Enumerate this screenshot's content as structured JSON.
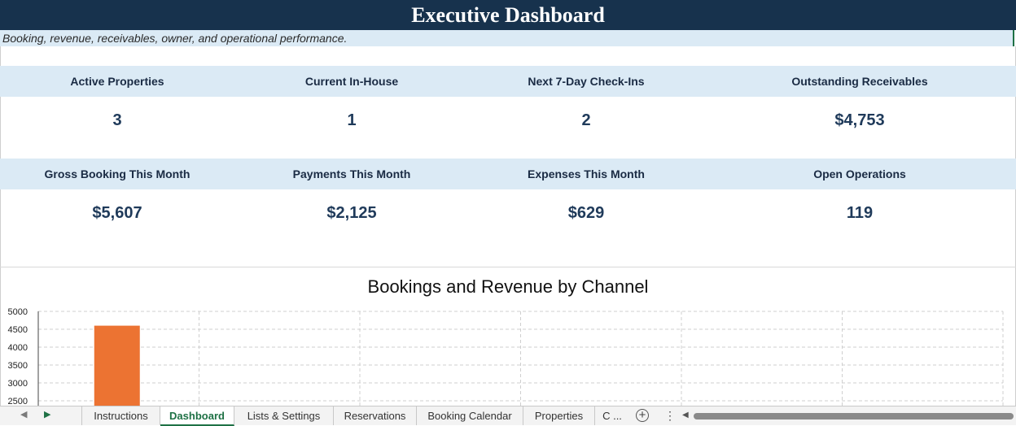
{
  "header": {
    "title": "Executive Dashboard",
    "subtitle": "Booking, revenue, receivables, owner, and operational performance."
  },
  "kpis_row1": [
    {
      "label": "Active Properties",
      "value": "3"
    },
    {
      "label": "Current In-House",
      "value": "1"
    },
    {
      "label": "Next 7-Day Check-Ins",
      "value": "2"
    },
    {
      "label": "Outstanding Receivables",
      "value": "$4,753"
    }
  ],
  "kpis_row2": [
    {
      "label": "Gross Booking This Month",
      "value": "$5,607"
    },
    {
      "label": "Payments This Month",
      "value": "$2,125"
    },
    {
      "label": "Expenses This Month",
      "value": "$629"
    },
    {
      "label": "Open Operations",
      "value": "119"
    }
  ],
  "chart_data": {
    "type": "bar",
    "title": "Bookings and Revenue by Channel",
    "y_ticks": [
      "5000",
      "4500",
      "4000",
      "3500",
      "3000",
      "2500"
    ],
    "ylim_visible": [
      2500,
      5000
    ],
    "grid": true,
    "categories_visible": 6,
    "series": [
      {
        "color": "#ec7332",
        "values": [
          4600
        ]
      }
    ]
  },
  "tabs": {
    "items": [
      {
        "label": "Instructions",
        "active": false
      },
      {
        "label": "Dashboard",
        "active": true
      },
      {
        "label": "Lists & Settings",
        "active": false
      },
      {
        "label": "Reservations",
        "active": false
      },
      {
        "label": "Booking Calendar",
        "active": false
      },
      {
        "label": "Properties",
        "active": false
      },
      {
        "label": "C ...",
        "active": false
      }
    ],
    "add_label": "+",
    "more_label": "⋮"
  },
  "colors": {
    "title_bg": "#17324d",
    "kpi_header_bg": "#dbeaf5",
    "active_tab": "#1e7145",
    "bar": "#ec7332"
  }
}
